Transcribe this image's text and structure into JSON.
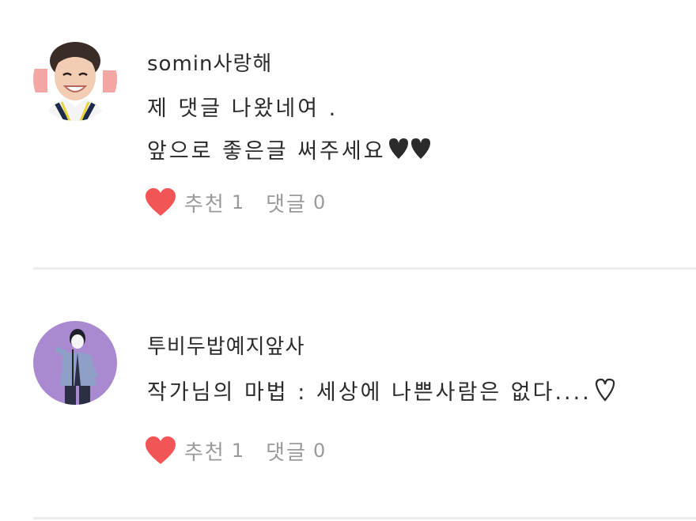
{
  "comments": [
    {
      "username": "somin사랑해",
      "lines": [
        "제 댓글 나왔네여 .",
        "앞으로 좋은글 써주세요"
      ],
      "like_label": "추천",
      "like_count": "1",
      "reply_label": "댓글",
      "reply_count": "0",
      "avatar_icon": "profile-photo-smiling-boy",
      "trailing_icon": "two-hearts-icon"
    },
    {
      "username": "투비두밥예지앞사",
      "lines": [
        "작가님의 마법 : 세상에 나쁜사람은 없다...."
      ],
      "like_label": "추천",
      "like_count": "1",
      "reply_label": "댓글",
      "reply_count": "0",
      "avatar_icon": "illustrated-singer-purple-background",
      "trailing_icon": "outline-heart-icon"
    }
  ],
  "colors": {
    "heart": "#f25555",
    "text": "#2b2b2b",
    "muted": "#9a9a9a",
    "divider": "#ececec",
    "avatar2_bg": "#a98ad0"
  }
}
